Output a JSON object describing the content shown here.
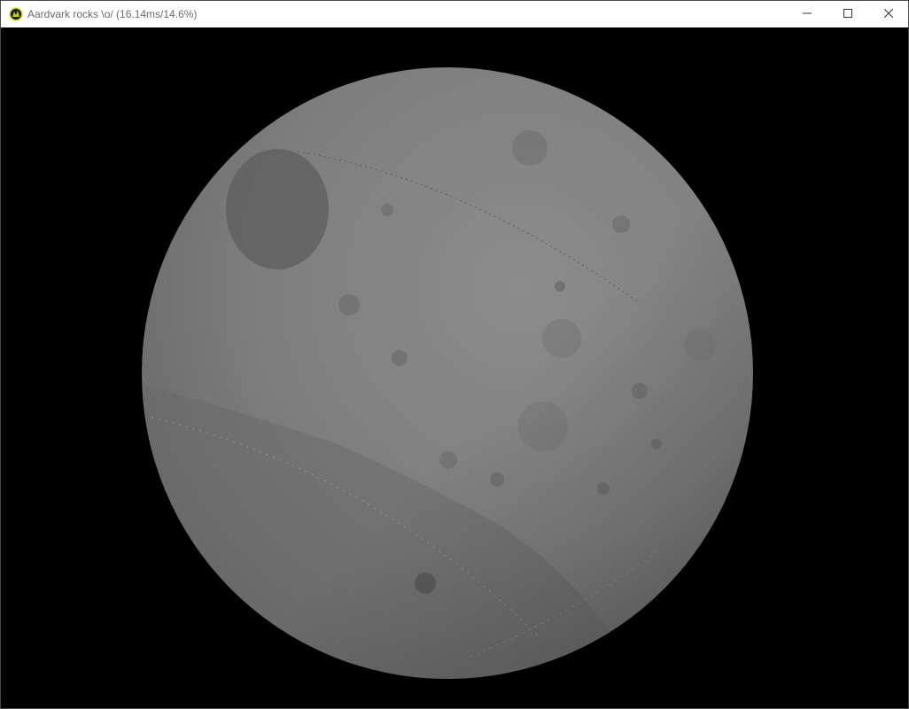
{
  "window": {
    "title": "Aardvark rocks \\o/ (16.14ms/14.6%)",
    "app_icon": "aardvark-logo-icon",
    "controls": {
      "minimize_icon": "minimize-icon",
      "maximize_icon": "maximize-icon",
      "close_icon": "close-icon"
    }
  },
  "scene": {
    "object": "moon-sphere",
    "background_color": "#000000",
    "surface_color": "#808080"
  }
}
